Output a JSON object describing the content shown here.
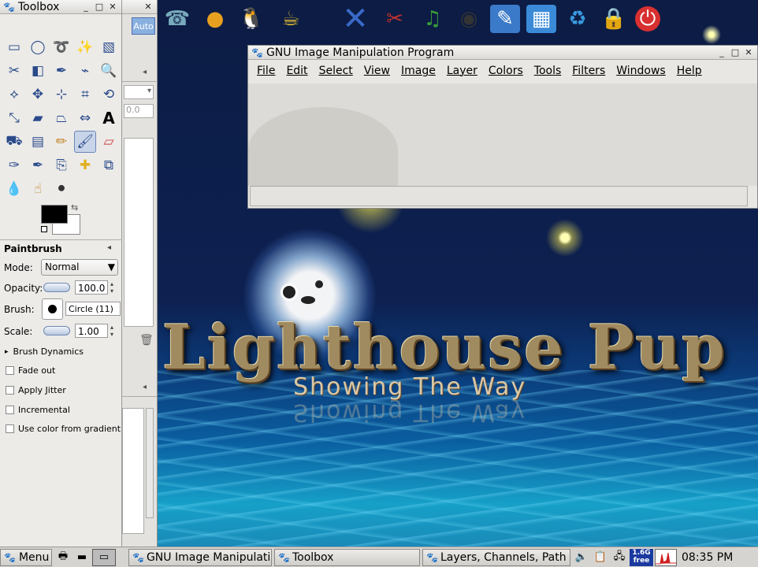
{
  "desktop": {
    "logo_title": "Lighthouse Pup",
    "logo_subtitle": "Showing The Way"
  },
  "icon_bar": {
    "icons": [
      "phone-icon",
      "globe-icon",
      "linux-penguin-icon",
      "teapot-icon",
      "abiword-icon",
      "tools-icon",
      "music-icon",
      "helmet-icon",
      "pen-edit-icon",
      "image-icon",
      "recycle-bin-icon",
      "lock-icon",
      "power-icon"
    ]
  },
  "toolbox": {
    "title": "Toolbox",
    "auto_label": "Auto",
    "paint_title": "Paintbrush",
    "mode_label": "Mode:",
    "mode_value": "Normal",
    "opacity_label": "Opacity:",
    "opacity_value": "100.0",
    "brush_label": "Brush:",
    "brush_value": "Circle (11)",
    "scale_label": "Scale:",
    "scale_value": "1.00",
    "brush_dynamics": "Brush Dynamics",
    "options": [
      "Fade out",
      "Apply Jitter",
      "Incremental",
      "Use color from gradient"
    ],
    "partial_value": "0.0"
  },
  "gimp": {
    "title": "GNU Image Manipulation Program",
    "menu": [
      "File",
      "Edit",
      "Select",
      "View",
      "Image",
      "Layer",
      "Colors",
      "Tools",
      "Filters",
      "Windows",
      "Help"
    ]
  },
  "taskbar": {
    "menu_label": "Menu",
    "tasks": [
      "GNU Image Manipulati",
      "Toolbox",
      "Layers, Channels, Path"
    ],
    "mem_line1": "1.6G",
    "mem_line2": "free",
    "clock": "08:35 PM"
  }
}
